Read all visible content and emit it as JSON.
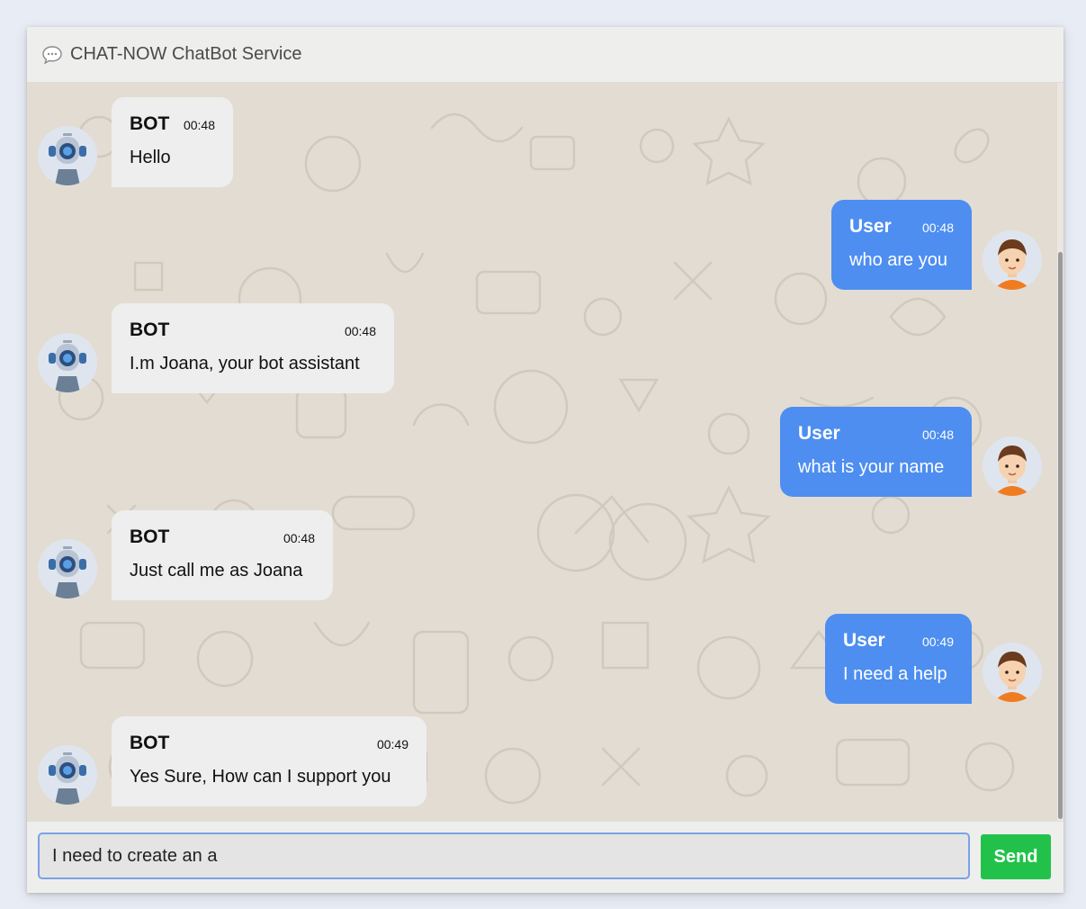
{
  "header": {
    "title": "CHAT-NOW ChatBot Service",
    "icon": "speech-bubble-icon"
  },
  "messages": [
    {
      "sender": "bot",
      "name": "BOT",
      "time": "00:48",
      "text": "Hello"
    },
    {
      "sender": "user",
      "name": "User",
      "time": "00:48",
      "text": "who are you"
    },
    {
      "sender": "bot",
      "name": "BOT",
      "time": "00:48",
      "text": "I.m Joana, your bot assistant"
    },
    {
      "sender": "user",
      "name": "User",
      "time": "00:48",
      "text": "what is your name"
    },
    {
      "sender": "bot",
      "name": "BOT",
      "time": "00:48",
      "text": "Just call me as Joana"
    },
    {
      "sender": "user",
      "name": "User",
      "time": "00:49",
      "text": "I need a help"
    },
    {
      "sender": "bot",
      "name": "BOT",
      "time": "00:49",
      "text": "Yes Sure, How can I support you"
    }
  ],
  "composer": {
    "value": "I need to create an a",
    "send_label": "Send"
  },
  "colors": {
    "user_bubble": "#4d8ef0",
    "bot_bubble": "#eeeeee",
    "send_button": "#22c24a",
    "chat_background": "#e3dcd3"
  }
}
